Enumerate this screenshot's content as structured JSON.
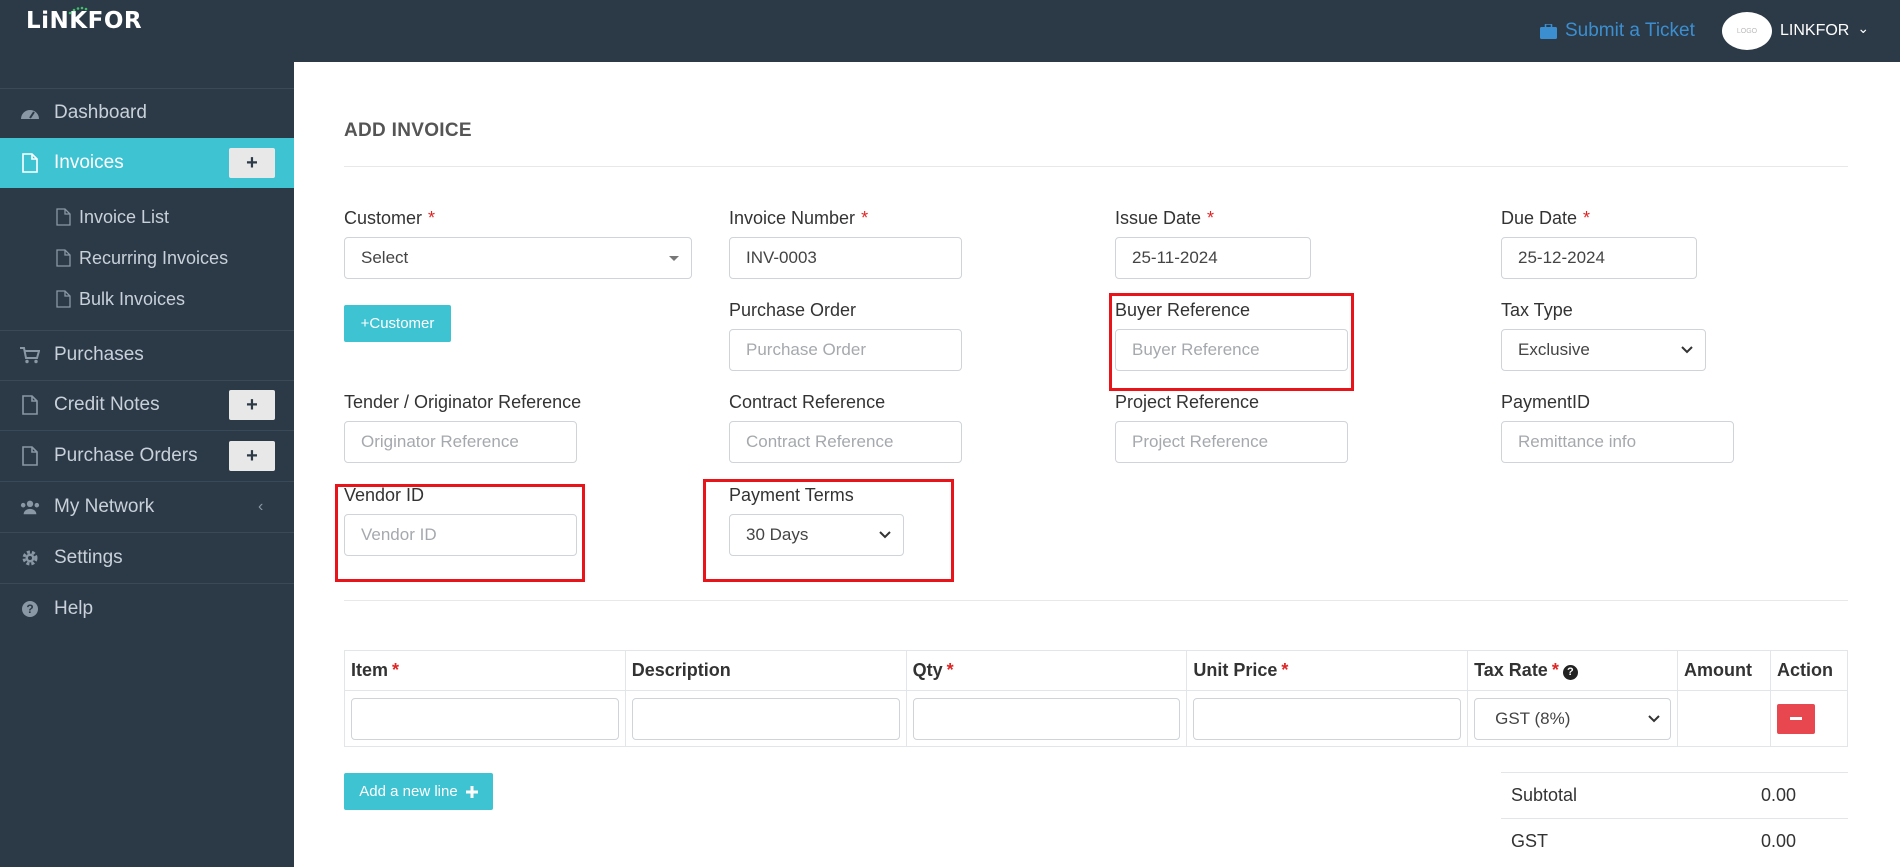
{
  "header": {
    "logo_text": "LiNKFOR",
    "submit_ticket_label": "Submit a Ticket",
    "avatar_text": "LOGO",
    "user_name": "LINKFOR",
    "user_chevron": "⌄"
  },
  "sidebar": {
    "items": [
      {
        "label": "Dashboard",
        "icon": "dashboard-icon"
      },
      {
        "label": "Invoices",
        "icon": "file-icon",
        "active": true
      },
      {
        "label": "Purchases",
        "icon": "cart-icon"
      },
      {
        "label": "Credit Notes",
        "icon": "file-icon"
      },
      {
        "label": "Purchase Orders",
        "icon": "file-icon"
      },
      {
        "label": "My Network",
        "icon": "users-icon"
      },
      {
        "label": "Settings",
        "icon": "gear-icon"
      },
      {
        "label": "Help",
        "icon": "question-icon"
      }
    ],
    "sub_items": [
      {
        "label": "Invoice List"
      },
      {
        "label": "Recurring Invoices"
      },
      {
        "label": "Bulk Invoices"
      }
    ],
    "plus_label": "+",
    "network_chevron": "‹"
  },
  "form": {
    "title": "ADD INVOICE",
    "required_mark": "*",
    "customer": {
      "label": "Customer",
      "value": "Select"
    },
    "add_customer_button": "+Customer",
    "invoice_number": {
      "label": "Invoice Number",
      "value": "INV-0003"
    },
    "issue_date": {
      "label": "Issue Date",
      "value": "25-11-2024"
    },
    "due_date": {
      "label": "Due Date",
      "value": "25-12-2024"
    },
    "purchase_order": {
      "label": "Purchase Order",
      "placeholder": "Purchase Order"
    },
    "buyer_reference": {
      "label": "Buyer Reference",
      "placeholder": "Buyer Reference"
    },
    "tax_type": {
      "label": "Tax Type",
      "value": "Exclusive"
    },
    "tender_reference": {
      "label": "Tender / Originator Reference",
      "placeholder": "Originator Reference"
    },
    "contract_reference": {
      "label": "Contract Reference",
      "placeholder": "Contract Reference"
    },
    "project_reference": {
      "label": "Project Reference",
      "placeholder": "Project Reference"
    },
    "payment_id": {
      "label": "PaymentID",
      "placeholder": "Remittance info"
    },
    "vendor_id": {
      "label": "Vendor ID",
      "placeholder": "Vendor ID"
    },
    "payment_terms": {
      "label": "Payment Terms",
      "value": "30 Days"
    }
  },
  "items_table": {
    "columns": [
      "Item",
      "Description",
      "Qty",
      "Unit Price",
      "Tax Rate",
      "Amount",
      "Action"
    ],
    "tax_rate_value": "GST (8%)",
    "help_mark": "?",
    "add_line_button": "Add a new line"
  },
  "totals": [
    {
      "label": "Subtotal",
      "value": "0.00"
    },
    {
      "label": "GST",
      "value": "0.00"
    }
  ],
  "colors": {
    "sidebar_bg": "#2c3947",
    "accent": "#3ec3d3",
    "required": "#e02424",
    "highlight_box": "#e8141a",
    "delete_button": "#e8474f",
    "link": "#3b8fd1"
  }
}
